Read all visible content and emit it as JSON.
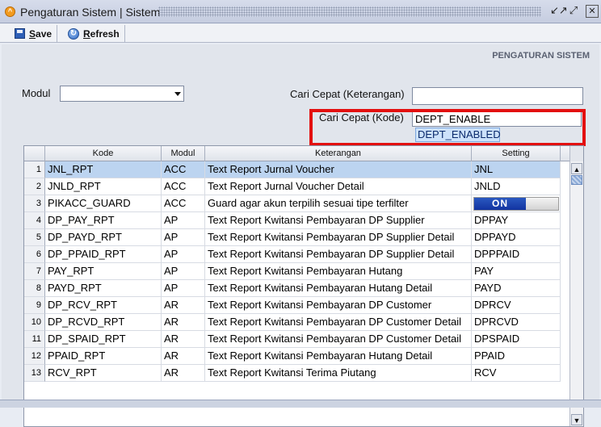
{
  "window": {
    "title": "Pengaturan Sistem | Sistem",
    "app_icon": "app-logo-icon",
    "buttons": {
      "minimize": "↙↗",
      "restore": "⤢",
      "close": "✕"
    }
  },
  "toolbar": {
    "save_label": "ave",
    "save_prefix": "S",
    "refresh_label": "efresh",
    "refresh_prefix": "R"
  },
  "panel": {
    "section_title": "PENGATURAN SISTEM",
    "modul_label": "Modul",
    "modul_value": "",
    "search_desc_label": "Cari Cepat (Keterangan)",
    "search_desc_value": "",
    "search_code_label": "Cari Cepat (Kode)",
    "search_code_value": "DEPT_ENABLE",
    "suggestion": "DEPT_ENABLED"
  },
  "grid": {
    "columns": [
      "Kode",
      "Modul",
      "Keterangan",
      "Setting"
    ],
    "rows": [
      {
        "no": "1",
        "kode": "JNL_RPT",
        "modul": "ACC",
        "ket": "Text Report Jurnal Voucher",
        "setting": "JNL"
      },
      {
        "no": "2",
        "kode": "JNLD_RPT",
        "modul": "ACC",
        "ket": "Text Report Jurnal Voucher Detail",
        "setting": "JNLD"
      },
      {
        "no": "3",
        "kode": "PIKACC_GUARD",
        "modul": "ACC",
        "ket": "Guard agar akun terpilih sesuai tipe terfilter",
        "setting": "ON"
      },
      {
        "no": "4",
        "kode": "DP_PAY_RPT",
        "modul": "AP",
        "ket": "Text Report Kwitansi Pembayaran DP Supplier",
        "setting": "DPPAY"
      },
      {
        "no": "5",
        "kode": "DP_PAYD_RPT",
        "modul": "AP",
        "ket": "Text Report Kwitansi Pembayaran DP Supplier Detail",
        "setting": "DPPAYD"
      },
      {
        "no": "6",
        "kode": "DP_PPAID_RPT",
        "modul": "AP",
        "ket": "Text Report Kwitansi Pembayaran DP Supplier Detail",
        "setting": "DPPPAID"
      },
      {
        "no": "7",
        "kode": "PAY_RPT",
        "modul": "AP",
        "ket": "Text Report Kwitansi Pembayaran Hutang",
        "setting": "PAY"
      },
      {
        "no": "8",
        "kode": "PAYD_RPT",
        "modul": "AP",
        "ket": "Text Report Kwitansi Pembayaran Hutang Detail",
        "setting": "PAYD"
      },
      {
        "no": "9",
        "kode": "DP_RCV_RPT",
        "modul": "AR",
        "ket": "Text Report Kwitansi Pembayaran DP Customer",
        "setting": "DPRCV"
      },
      {
        "no": "10",
        "kode": "DP_RCVD_RPT",
        "modul": "AR",
        "ket": "Text Report Kwitansi Pembayaran DP Customer Detail",
        "setting": "DPRCVD"
      },
      {
        "no": "11",
        "kode": "DP_SPAID_RPT",
        "modul": "AR",
        "ket": "Text Report Kwitansi Pembayaran DP Customer Detail",
        "setting": "DPSPAID"
      },
      {
        "no": "12",
        "kode": "PPAID_RPT",
        "modul": "AR",
        "ket": "Text Report Kwitansi Pembayaran Hutang Detail",
        "setting": "PPAID"
      },
      {
        "no": "13",
        "kode": "RCV_RPT",
        "modul": "AR",
        "ket": "Text Report Kwitansi Terima Piutang",
        "setting": "RCV"
      }
    ]
  },
  "colors": {
    "highlight": "#e31010",
    "selected_row": "#bcd4f0",
    "toggle_on": "#1a3fae"
  }
}
